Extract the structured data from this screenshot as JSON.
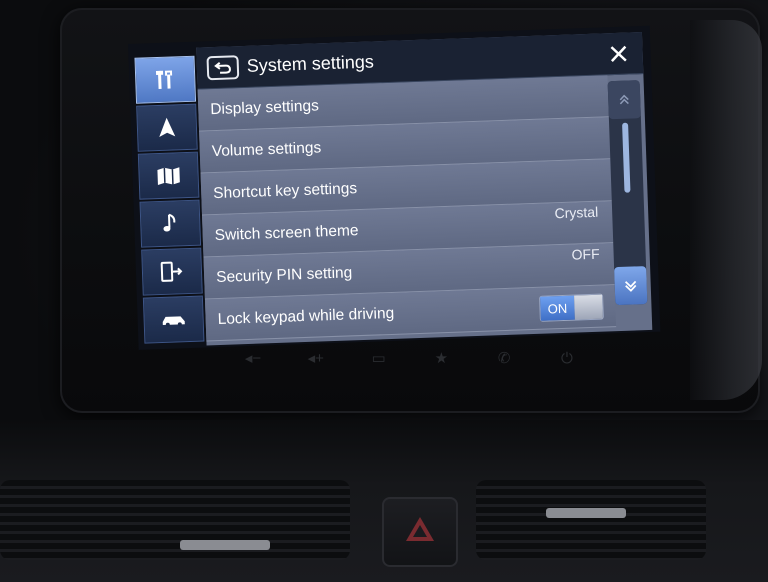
{
  "header": {
    "title": "System settings"
  },
  "rail": {
    "items": [
      {
        "icon": "settings-tools-icon",
        "active": true
      },
      {
        "icon": "navigation-arrow-icon",
        "active": false
      },
      {
        "icon": "map-icon",
        "active": false
      },
      {
        "icon": "music-note-icon",
        "active": false
      },
      {
        "icon": "phone-projection-icon",
        "active": false
      },
      {
        "icon": "car-icon",
        "active": false
      }
    ]
  },
  "settings": {
    "rows": [
      {
        "label": "Display settings",
        "value": ""
      },
      {
        "label": "Volume settings",
        "value": ""
      },
      {
        "label": "Shortcut key settings",
        "value": ""
      },
      {
        "label": "Switch screen theme",
        "value": "Crystal"
      },
      {
        "label": "Security PIN setting",
        "value": "OFF"
      },
      {
        "label": "Lock keypad while driving",
        "toggle": "ON"
      }
    ]
  },
  "colors": {
    "accent": "#5b86d6",
    "titlebar": "#1a2233",
    "row": "#66708a"
  }
}
